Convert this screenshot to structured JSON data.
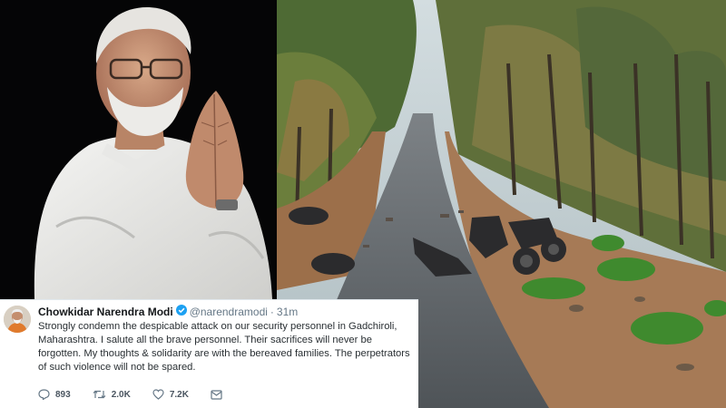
{
  "tweet": {
    "author_name": "Chowkidar Narendra Modi",
    "handle": "@narendramodi",
    "separator": "·",
    "time_ago": "31m",
    "text": "Strongly condemn the despicable attack on our security personnel in Gadchiroli, Maharashtra. I salute all the brave personnel. Their sacrifices will never be forgotten. My thoughts & solidarity are with the bereaved families. The perpetrators of such violence will not be spared.",
    "replies": "893",
    "retweets": "2.0K",
    "likes": "7.2K"
  },
  "icons": {
    "verified": "verified-badge-icon",
    "reply": "reply-icon",
    "retweet": "retweet-icon",
    "like": "heart-icon",
    "message": "direct-message-icon"
  },
  "colors": {
    "verified_blue": "#1da1f2",
    "muted_gray": "#657786"
  }
}
